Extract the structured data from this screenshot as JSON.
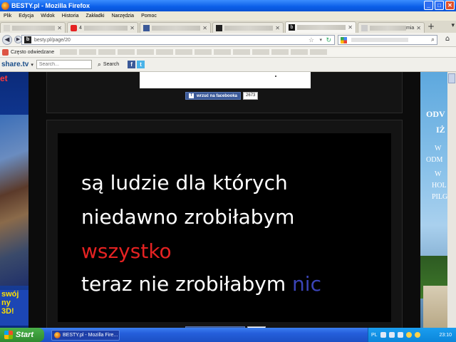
{
  "window": {
    "title": "BESTY.pl - Mozilla Firefox",
    "minimize": "_",
    "maximize": "□",
    "close": "✕"
  },
  "menu": [
    "Plik",
    "Edycja",
    "Widok",
    "Historia",
    "Zakładki",
    "Narzędzia",
    "Pomoc"
  ],
  "tabs": [
    {
      "label": "",
      "icon": "page-icon",
      "color": "#d7d5ce"
    },
    {
      "label": "4",
      "icon": "youtube-icon",
      "color": "#e52222"
    },
    {
      "label": "",
      "icon": "facebook-icon",
      "color": "#3b5998"
    },
    {
      "label": "",
      "icon": "media-icon",
      "color": "#222222"
    },
    {
      "label": "",
      "icon": "besty-icon",
      "color": "#111111"
    },
    {
      "label": "mia",
      "icon": "page-icon",
      "color": "#cccccc"
    }
  ],
  "newtab_label": "+",
  "address": {
    "url": "besty.pl/page/20",
    "site_letter": "b"
  },
  "bookmarks": {
    "most_visited": "Często odwiedzane"
  },
  "share_toolbar": {
    "logo": "share.tv",
    "search_placeholder": "Search...",
    "search_button": "Search"
  },
  "left_ad": {
    "title": "et",
    "promo_line1": "swój",
    "promo_line2": "ny",
    "promo_line3": "3D!"
  },
  "right_ad": {
    "line1": "ODV",
    "line2": "IŻ",
    "line3": "W",
    "line4": "ODM",
    "line5": "W",
    "line6": "HOL",
    "line7": "PILG"
  },
  "post1": {
    "fb_label": "wrzuć na facebooka",
    "fb_count": "2673"
  },
  "post2": {
    "quote_line1": "są ludzie dla których",
    "quote_line2": "niedawno zrobiłabym",
    "quote_line3": "wszystko",
    "quote_line4_a": "teraz nie zrobiłabym ",
    "quote_line4_b": "nic",
    "highlight_red": "#e52222",
    "highlight_blue": "#3b44b8"
  },
  "taskbar": {
    "start": "Start",
    "task_label": "BESTY.pl - Mozilla Fire...",
    "lang": "PL",
    "clock": "23:10"
  }
}
